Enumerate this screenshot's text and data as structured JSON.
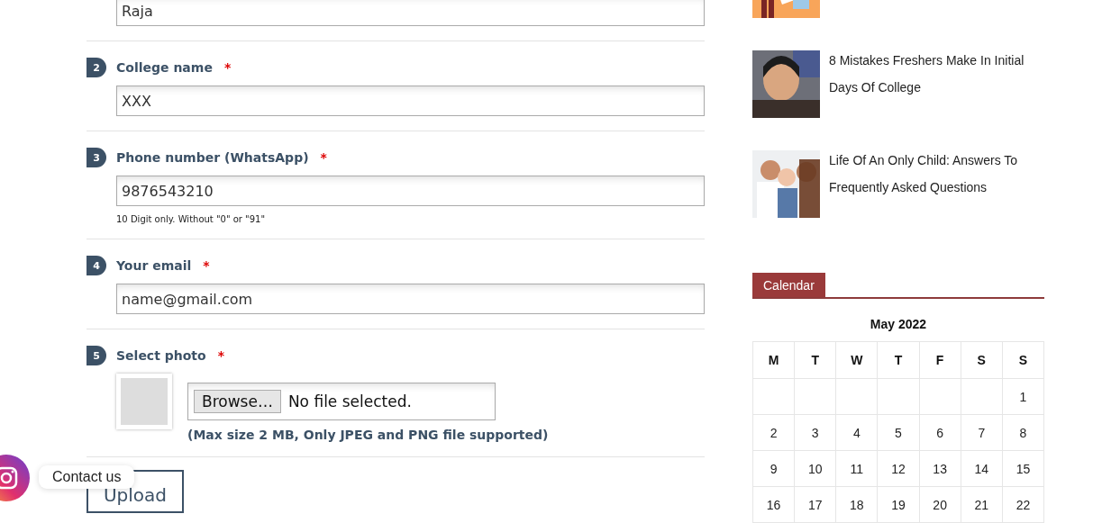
{
  "form": {
    "fields": [
      {
        "kind": "text",
        "value": "Raja"
      },
      {
        "kind": "text",
        "number": "2",
        "label": "College name",
        "required": "*",
        "value": "XXX"
      },
      {
        "kind": "text",
        "number": "3",
        "label": "Phone number (WhatsApp)",
        "required": "*",
        "value": "9876543210",
        "hint": "10 Digit only. Without \"0\" or \"91\""
      },
      {
        "kind": "text",
        "number": "4",
        "label": "Your email",
        "required": "*",
        "value": "name@gmail.com"
      },
      {
        "kind": "file",
        "number": "5",
        "label": "Select photo",
        "required": "*",
        "button": "Browse…",
        "status": "No file selected.",
        "hint": "(Max size 2 MB, Only JPEG and PNG file supported)"
      }
    ],
    "submit": "Upload"
  },
  "contact": {
    "label": "Contact us"
  },
  "sidebar": {
    "posts": [
      {
        "thumbnail": {
          "kind": "picture"
        }
      },
      {
        "title": "8 Mistakes Freshers Make In Initial Days Of College",
        "thumbnail": {
          "kind": "picture"
        }
      },
      {
        "title": "Life Of An Only Child: Answers To Frequently Asked Questions",
        "thumbnail": {
          "kind": "picture"
        }
      }
    ],
    "calendar": {
      "title": "Calendar",
      "month": "May 2022",
      "weekdays": [
        "M",
        "T",
        "W",
        "T",
        "F",
        "S",
        "S"
      ],
      "weeks": [
        [
          {
            "blank": true
          },
          {
            "blank": true
          },
          {
            "blank": true
          },
          {
            "blank": true
          },
          {
            "blank": true
          },
          {
            "blank": true
          },
          "1"
        ],
        [
          "2",
          "3",
          "4",
          "5",
          "6",
          "7",
          "8"
        ],
        [
          "9",
          "10",
          "11",
          "12",
          "13",
          "14",
          "15"
        ],
        [
          "16",
          "17",
          "18",
          "19",
          "20",
          "21",
          "22"
        ]
      ]
    }
  }
}
